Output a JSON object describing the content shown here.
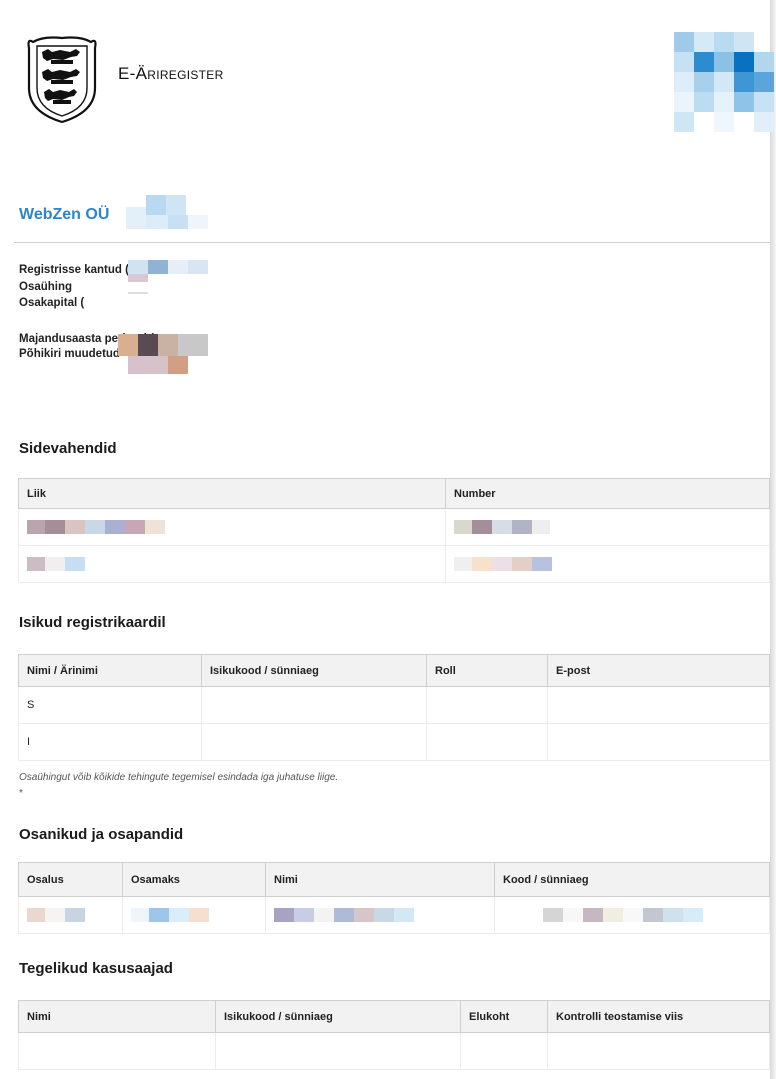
{
  "header": {
    "brand": "E-Äriregister",
    "emblem_icon": "estonian-coat-of-arms-icon",
    "logo_icon": "pixel-mosaic-logo-icon"
  },
  "company": {
    "name": "WebZen OÜ"
  },
  "meta": [
    {
      "label": "Registrisse kantud ("
    },
    {
      "label": "Osaühing"
    },
    {
      "label": "Osakapital ("
    },
    {
      "label": "Majandusaasta periood ("
    },
    {
      "label": "Põhikiri muudetud"
    }
  ],
  "sections": {
    "contacts": {
      "title": "Sidevahendid",
      "columns": [
        "Liik",
        "Number"
      ]
    },
    "persons": {
      "title": "Isikud registrikaardil",
      "columns": [
        "Nimi / Ärinimi",
        "Isikukood / sünniaeg",
        "Roll",
        "E-post"
      ],
      "row_initials": [
        "S",
        "I"
      ],
      "note": "Osaühingut võib kõikide tehingute tegemisel esindada iga juhatuse liige.",
      "star": "*"
    },
    "shareholders": {
      "title": "Osanikud ja osapandid",
      "columns": [
        "Osalus",
        "Osamaks",
        "Nimi",
        "Kood / sünniaeg"
      ]
    },
    "beneficiaries": {
      "title": "Tegelikud kasusaajad",
      "columns": [
        "Nimi",
        "Isikukood / sünniaeg",
        "Elukoht",
        "Kontrolli teostamise viis"
      ]
    }
  },
  "colors": {
    "accent": "#2f86c6",
    "header_bg": "#f2f2f2",
    "border": "#cfcfcf"
  }
}
